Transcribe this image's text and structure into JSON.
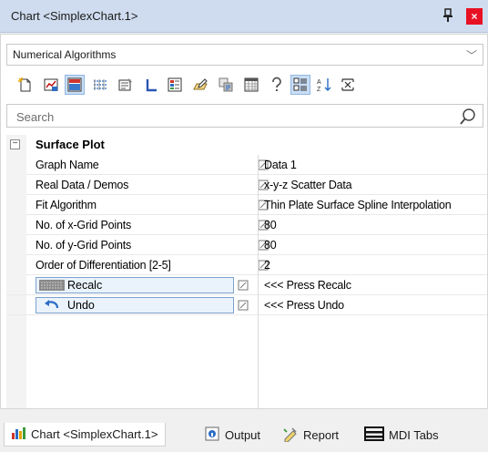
{
  "window": {
    "title": "Chart <SimplexChart.1>",
    "pin_icon": "pin-icon",
    "close_icon": "close-icon",
    "close_glyph": "×"
  },
  "combo": {
    "selected": "Numerical Algorithms",
    "arrow_glyph": "﹀"
  },
  "toolbar": {
    "buttons": [
      {
        "name": "new-chart-icon",
        "active": false
      },
      {
        "name": "chart-properties-icon",
        "active": false
      },
      {
        "name": "chart-area-icon",
        "active": true
      },
      {
        "name": "data-series-icon",
        "active": false
      },
      {
        "name": "settings-icon",
        "active": false
      },
      {
        "name": "axis-icon",
        "active": false
      },
      {
        "name": "legend-icon",
        "active": false
      },
      {
        "name": "edit-icon",
        "active": false
      },
      {
        "name": "copy-icon",
        "active": false
      },
      {
        "name": "grid-table-icon",
        "active": false
      },
      {
        "name": "help-icon",
        "active": false
      },
      {
        "name": "categorized-icon",
        "active": true
      },
      {
        "name": "sort-alphabetical-icon",
        "active": false
      },
      {
        "name": "collapse-icon",
        "active": false
      }
    ]
  },
  "search": {
    "placeholder": "Search"
  },
  "property_grid": {
    "category": {
      "label": "Surface Plot",
      "toggle_glyph": "−"
    },
    "rows": [
      {
        "label": "Graph Name",
        "value": "Data 1"
      },
      {
        "label": "Real Data / Demos",
        "value": "x-y-z Scatter Data"
      },
      {
        "label": "Fit Algorithm",
        "value": "Thin Plate Surface Spline Interpolation"
      },
      {
        "label": "No. of x-Grid Points",
        "value": "80"
      },
      {
        "label": "No. of y-Grid Points",
        "value": "80"
      },
      {
        "label": "Order of Differentiation [2-5]",
        "value": "2"
      }
    ],
    "buttons": [
      {
        "label": "Recalc",
        "value": "<<< Press Recalc",
        "icon": "calculator-icon"
      },
      {
        "label": "Undo",
        "value": "<<< Press Undo",
        "icon": "undo-icon"
      }
    ]
  },
  "bottom_tabs": [
    {
      "label": "Chart <SimplexChart.1>",
      "icon": "chart-icon",
      "active": true
    },
    {
      "label": "Output",
      "icon": "output-icon",
      "active": false
    },
    {
      "label": "Report",
      "icon": "report-icon",
      "active": false
    },
    {
      "label": "MDI Tabs",
      "icon": "mdi-tabs-icon",
      "active": false
    }
  ]
}
